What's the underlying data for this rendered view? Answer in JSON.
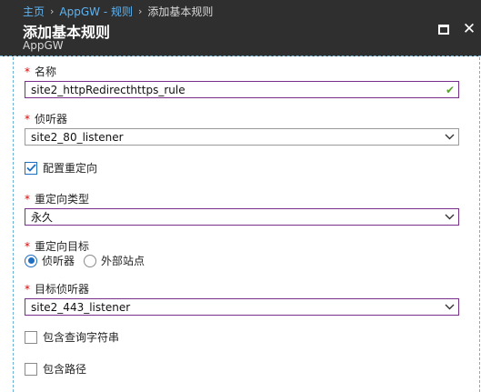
{
  "header": {
    "breadcrumb": [
      "主页",
      "AppGW - 规则",
      "添加基本规则"
    ],
    "breadcrumb_separator": "›",
    "title": "添加基本规则",
    "subtitle": "AppGW",
    "close_glyph": "✕"
  },
  "form": {
    "name": {
      "label": "名称",
      "required": "*",
      "value": "site2_httpRedirecthttps_rule",
      "valid_glyph": "✔"
    },
    "listener": {
      "label": "侦听器",
      "required": "*",
      "value": "site2_80_listener"
    },
    "configure_redirect": {
      "label": "配置重定向",
      "checked": true
    },
    "redirect_type": {
      "label": "重定向类型",
      "required": "*",
      "value": "永久"
    },
    "redirect_target": {
      "label": "重定向目标",
      "required": "*",
      "options": [
        "侦听器",
        "外部站点"
      ],
      "selected": "侦听器"
    },
    "target_listener": {
      "label": "目标侦听器",
      "required": "*",
      "value": "site2_443_listener"
    },
    "include_query_string": {
      "label": "包含查询字符串",
      "checked": false
    },
    "include_path": {
      "label": "包含路径",
      "checked": false
    }
  },
  "colors": {
    "header_bg": "#2f2f2f",
    "link": "#5fb3f0",
    "focus_border": "#7a2e8c",
    "required": "#e00000",
    "valid": "#5aa02c",
    "accent": "#1e6fc0"
  },
  "icons": {
    "maximize": "maximize-icon",
    "close": "close-icon",
    "dropdown": "chevron-down-icon",
    "valid": "check-icon",
    "checkbox_check": "checkmark-icon"
  }
}
